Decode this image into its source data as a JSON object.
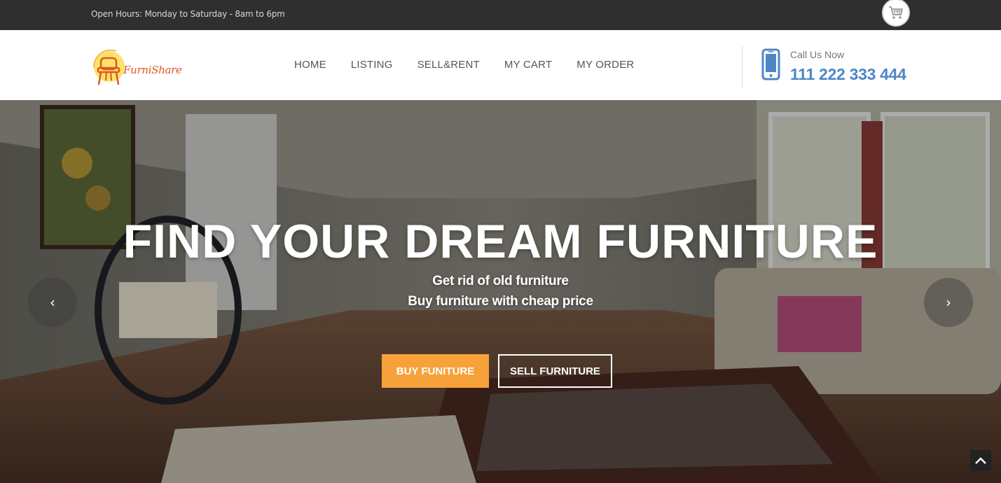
{
  "topbar": {
    "hours": "Open Hours: Monday to Saturday - 8am to 6pm",
    "cart_icon": "cart-icon"
  },
  "header": {
    "logo_text": "FurniShare",
    "nav": [
      "HOME",
      "LISTING",
      "SELL&RENT",
      "MY CART",
      "MY ORDER"
    ],
    "call_label": "Call Us Now",
    "call_number": "111 222 333 444",
    "phone_icon": "phone-icon"
  },
  "hero": {
    "title": "FIND YOUR DREAM FURNITURE",
    "subtitle_line1": "Get rid of old furniture",
    "subtitle_line2": "Buy furniture with cheap price",
    "buy_button": "BUY FUNITURE",
    "sell_button": "SELL FURNITURE",
    "prev_arrow": "‹",
    "next_arrow": "›"
  },
  "colors": {
    "topbar_bg": "#2f2f2f",
    "accent_orange": "#f7a13a",
    "phone_blue": "#4e86c8",
    "logo_orange": "#e2561f"
  }
}
